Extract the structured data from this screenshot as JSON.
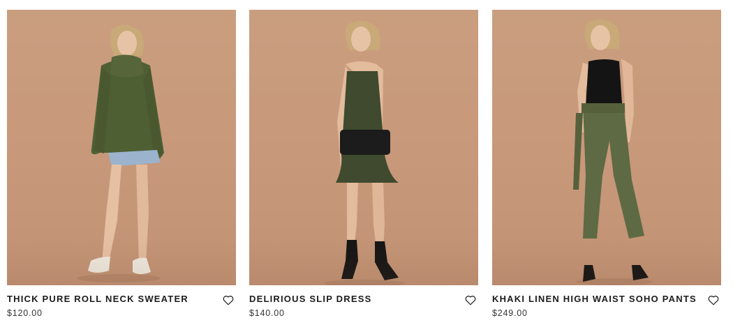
{
  "products": [
    {
      "name": "THICK PURE ROLL NECK SWEATER",
      "price": "$120.00",
      "image_icon": "model-green-rollneck-sweater"
    },
    {
      "name": "DELIRIOUS SLIP DRESS",
      "price": "$140.00",
      "image_icon": "model-green-slip-dress"
    },
    {
      "name": "KHAKI LINEN HIGH WAIST SOHO PANTS",
      "price": "$249.00",
      "image_icon": "model-khaki-linen-pants"
    }
  ],
  "colors": {
    "backdrop": "#c99e7f",
    "garment_green": "#4f5f34",
    "text": "#1b1b1b"
  },
  "wishlist_icon": "heart-outline-icon"
}
